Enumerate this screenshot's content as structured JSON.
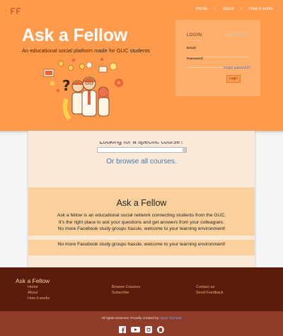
{
  "nav": {
    "items": [
      "Home",
      "About",
      "How it works"
    ]
  },
  "hero": {
    "title": "Ask a Fellow",
    "subtitle": "An educational social platform made for GUC students"
  },
  "login": {
    "tab_login": "LOGIN",
    "tab_register": "REGISTER",
    "email_label": "Email",
    "password_label": "Password",
    "forgot_label": "Forgot password?",
    "submit_label": "Login"
  },
  "main": {
    "search_prompt": "Looking for a specific course?",
    "browse_label": "Or browse all courses.",
    "about_title": "Ask a Fellow",
    "about_lines": [
      "Ask a fellow is an educational social network connecting students from the GUC.",
      "It's the right place to ask your questions and get answers from your colleagues.",
      "No more Facebook study groups hassle, welcome to your learning environment!"
    ],
    "repeat_line": "No more Facebook study groups hassle, welcome to your learning environment!"
  },
  "footer": {
    "brand": "Ask a Fellow",
    "col1": [
      "Home",
      "About",
      "How it works"
    ],
    "col2": [
      "Browse Courses",
      "Subscribe"
    ],
    "col3": [
      "Contact us",
      "Send Feedback"
    ],
    "rights": "All rights reserved. Proudly created by ",
    "creator": "Aplus Techhub",
    "social_icons": [
      "facebook-icon",
      "youtube-icon",
      "instagram-icon",
      "github-icon"
    ]
  },
  "colors": {
    "hero": "#fd9a4b",
    "login_card": "#fdae6b",
    "footer": "#5a1b0b",
    "footer_bottom": "#8f3d2a",
    "link": "#3a7abf"
  }
}
